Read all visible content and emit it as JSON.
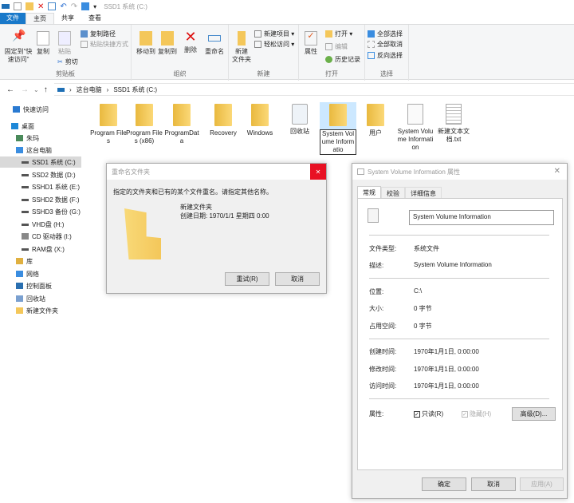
{
  "window": {
    "title": "SSD1 系统 (C:)"
  },
  "ribbon_tabs": [
    "文件",
    "主页",
    "共享",
    "查看"
  ],
  "ribbon": {
    "clipboard": {
      "label": "剪贴板",
      "pin": "固定到\"快速访问\"",
      "copy": "复制",
      "paste": "粘贴",
      "copy_path": "复制路径",
      "paste_shortcut": "粘贴快捷方式",
      "cut": "剪切"
    },
    "organize": {
      "label": "组织",
      "move_to": "移动到",
      "copy_to": "复制到",
      "delete": "删除",
      "rename": "重命名"
    },
    "new": {
      "label": "新建",
      "new_folder": "新建\n文件夹",
      "new_item": "新建项目 ▾",
      "easy_access": "轻松访问 ▾"
    },
    "open": {
      "label": "打开",
      "properties": "属性",
      "open": "打开 ▾",
      "edit": "编辑",
      "history": "历史记录"
    },
    "select": {
      "label": "选择",
      "select_all": "全部选择",
      "select_none": "全部取消",
      "invert": "反向选择"
    }
  },
  "address": {
    "crumbs": [
      "这台电脑",
      "SSD1 系统 (C:)"
    ]
  },
  "nav": [
    {
      "label": "快速访问",
      "icon": "star-icon"
    },
    {
      "label": "桌面",
      "icon": "desktop-icon"
    },
    {
      "label": "朱玛",
      "icon": "user-icon"
    },
    {
      "label": "这台电脑",
      "icon": "computer-icon"
    },
    {
      "label": "SSD1 系统 (C:)",
      "icon": "drive-icon",
      "selected": true
    },
    {
      "label": "SSD2 数据 (D:)",
      "icon": "drive-icon"
    },
    {
      "label": "SSHD1 系统 (E:)",
      "icon": "drive-icon"
    },
    {
      "label": "SSHD2 数据 (F:)",
      "icon": "drive-icon"
    },
    {
      "label": "SSHD3 备份 (G:)",
      "icon": "drive-icon"
    },
    {
      "label": "VHD盘 (H:)",
      "icon": "drive-icon"
    },
    {
      "label": "CD 驱动器 (I:)",
      "icon": "cd-drive-icon"
    },
    {
      "label": "RAM盘 (X:)",
      "icon": "drive-icon"
    },
    {
      "label": "库",
      "icon": "library-icon"
    },
    {
      "label": "网络",
      "icon": "network-icon"
    },
    {
      "label": "控制面板",
      "icon": "control-panel-icon"
    },
    {
      "label": "回收站",
      "icon": "recycle-bin-icon"
    },
    {
      "label": "新建文件夹",
      "icon": "folder-icon"
    }
  ],
  "files": [
    {
      "label": "Program Files",
      "type": "folder"
    },
    {
      "label": "Program Files (x86)",
      "type": "folder"
    },
    {
      "label": "ProgramData",
      "type": "folder"
    },
    {
      "label": "Recovery",
      "type": "folder"
    },
    {
      "label": "Windows",
      "type": "folder"
    },
    {
      "label": "回收站",
      "type": "recycle"
    },
    {
      "label": "System Volume Informatio",
      "type": "folder",
      "selected": true
    },
    {
      "label": "用户",
      "type": "folder"
    },
    {
      "label": "System Volume Information",
      "type": "sysfile"
    },
    {
      "label": "新建文本文档.txt",
      "type": "text"
    }
  ],
  "rename_dialog": {
    "title": "重命名文件夹",
    "message": "指定的文件夹和已有的某个文件重名。请指定其他名称。",
    "name": "新建文件夹",
    "created": "创建日期: 1970/1/1 星期四 0:00",
    "retry": "重试(R)",
    "cancel": "取消",
    "close": "✕",
    "close_color": "#e81123"
  },
  "properties": {
    "title": "System Volume Information 属性",
    "tabs": [
      "常规",
      "校验",
      "详细信息"
    ],
    "name": "System Volume Information",
    "type_label": "文件类型:",
    "type": "系统文件",
    "desc_label": "描述:",
    "desc": "System Volume Information",
    "loc_label": "位置:",
    "loc": "C:\\",
    "size_label": "大小:",
    "size": "0 字节",
    "disk_label": "占用空间:",
    "disk": "0 字节",
    "created_label": "创建时间:",
    "created": "1970年1月1日, 0:00:00",
    "modified_label": "修改时间:",
    "modified": "1970年1月1日, 0:00:00",
    "accessed_label": "访问时间:",
    "accessed": "1970年1月1日, 0:00:00",
    "attr_label": "属性:",
    "readonly": "只读(R)",
    "readonly_checked": true,
    "hidden": "隐藏(H)",
    "hidden_checked": true,
    "advanced": "高级(D)...",
    "ok": "确定",
    "cancel": "取消",
    "apply": "应用(A)"
  },
  "colors": {
    "accent": "#1979ca",
    "folder": "#f4c75a",
    "selection": "#cce8ff"
  }
}
